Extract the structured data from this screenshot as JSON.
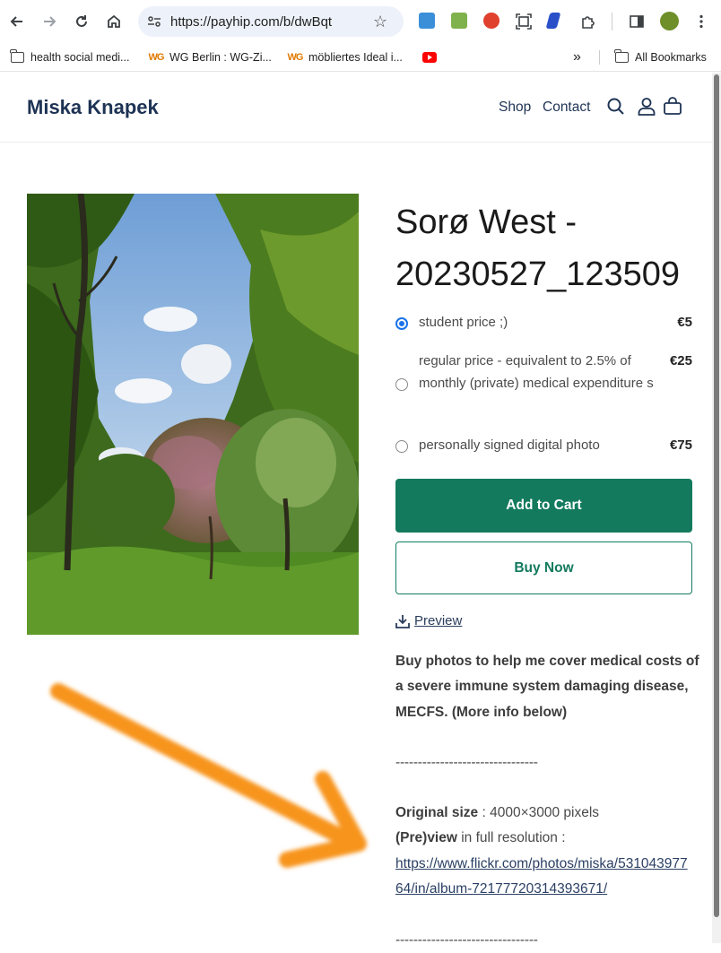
{
  "browser": {
    "url": "https://payhip.com/b/dwBqt",
    "bookmarks": [
      {
        "label": "health social medi...",
        "icon": "folder-icon"
      },
      {
        "label": "WG Berlin : WG-Zi...",
        "icon": "wg-icon"
      },
      {
        "label": "möbliertes Ideal i...",
        "icon": "wg-icon"
      },
      {
        "label": "",
        "icon": "youtube-icon"
      }
    ],
    "overflow_label": "»",
    "all_bookmarks_label": "All Bookmarks"
  },
  "header": {
    "brand": "Miska Knapek",
    "nav": {
      "shop": "Shop",
      "contact": "Contact"
    }
  },
  "product": {
    "title_line1": "Sorø West -",
    "title_line2": "20230527_123509",
    "options": [
      {
        "label": "student price ;)",
        "price": "€5",
        "selected": true
      },
      {
        "label": "regular price - equivalent to 2.5% of monthly (private) medical expenditure s",
        "price": "€25",
        "selected": false
      },
      {
        "label": "personally signed digital photo",
        "price": "€75",
        "selected": false
      }
    ],
    "add_to_cart": "Add to Cart",
    "buy_now": "Buy Now",
    "preview": "Preview"
  },
  "description": {
    "intro": "Buy photos to help me cover medical costs of a severe immune system damaging disease, MECFS. (More info below)",
    "divider": "--------------------------------",
    "size_label": "Original size",
    "size_value": " : 4000×3000 pixels",
    "preview_label": "(Pre)view",
    "preview_value": " in full resolution :",
    "flickr_link": "https://www.flickr.com/photos/miska/53104397764/in/album-72177720314393671/"
  },
  "colors": {
    "brand": "#1e3354",
    "primary_button": "#137a5e",
    "radio_selected": "#1a73e8",
    "annotation_arrow": "#f7941d"
  }
}
